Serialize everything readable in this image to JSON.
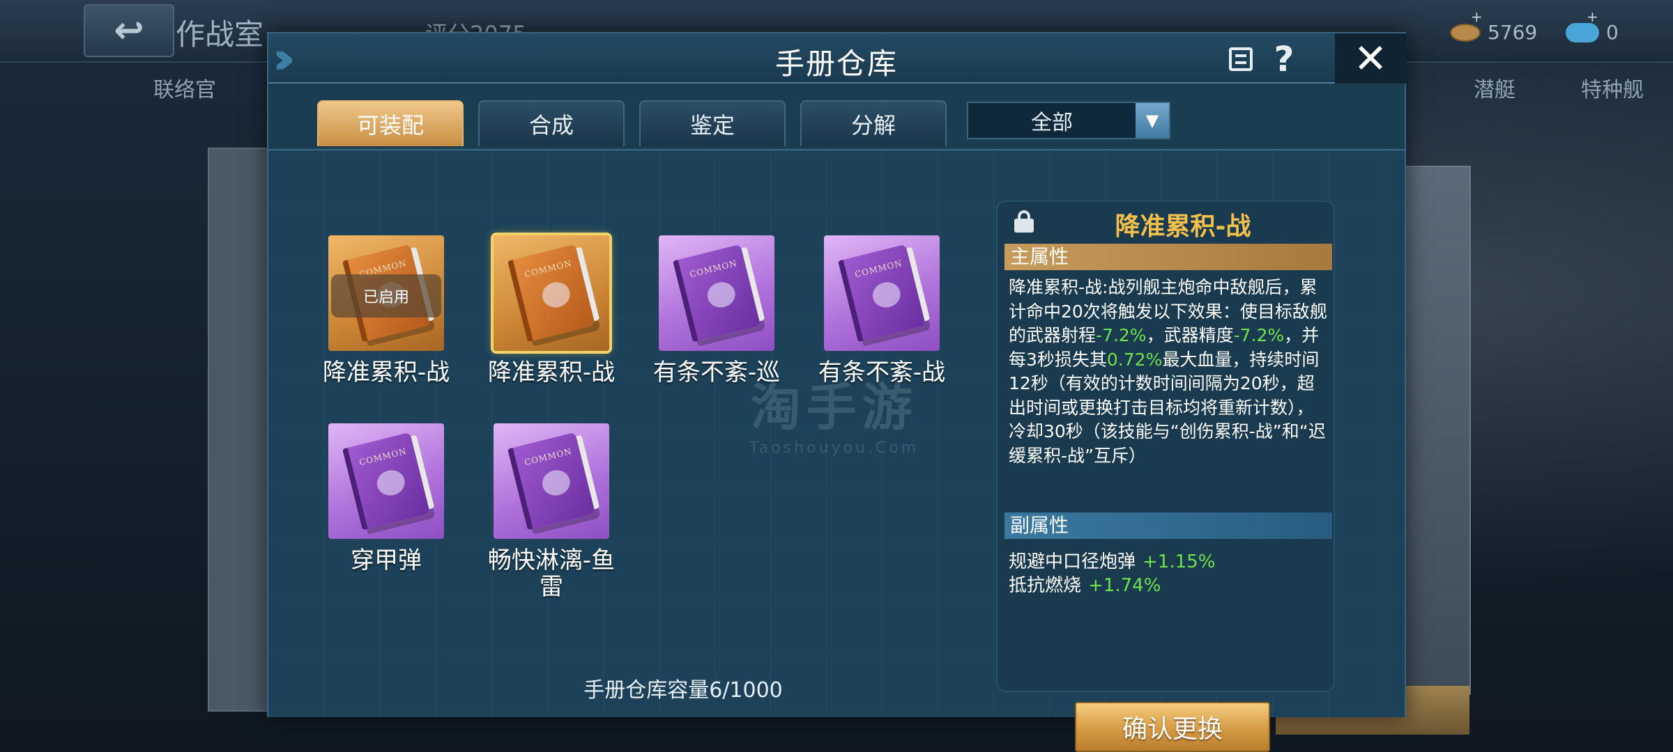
{
  "background": {
    "title": "作战室",
    "score": "评分2075",
    "resources": [
      "5769",
      "0"
    ],
    "tabs": [
      "联络官",
      "潜艇",
      "特种舰"
    ]
  },
  "modal": {
    "title": "手册仓库",
    "tabs": [
      {
        "label": "可装配",
        "active": true
      },
      {
        "label": "合成",
        "active": false
      },
      {
        "label": "鉴定",
        "active": false
      },
      {
        "label": "分解",
        "active": false
      }
    ],
    "filter": {
      "selected": "全部"
    },
    "items": [
      {
        "name": "降准累积-战",
        "color": "orange",
        "cover_text": "COMMON",
        "badge": "已启用",
        "selected": false
      },
      {
        "name": "降准累积-战",
        "color": "orange",
        "cover_text": "COMMON",
        "badge": "",
        "selected": true
      },
      {
        "name": "有条不紊-巡",
        "color": "purple",
        "cover_text": "COMMON",
        "badge": "",
        "selected": false
      },
      {
        "name": "有条不紊-战",
        "color": "purple",
        "cover_text": "COMMON",
        "badge": "",
        "selected": false
      },
      {
        "name": "穿甲弹",
        "color": "purple",
        "cover_text": "COMMON",
        "badge": "",
        "selected": false
      },
      {
        "name": "畅快淋漓-鱼雷",
        "color": "purple",
        "cover_text": "COMMON",
        "badge": "",
        "selected": false
      }
    ],
    "watermark": {
      "main": "淘手游",
      "sub": "Taoshouyou.Com"
    },
    "capacity": "手册仓库容量6/1000",
    "detail": {
      "title": "降准累积-战",
      "main_attr_label": "主属性",
      "desc_parts": [
        {
          "t": "降准累积-战:战列舰主炮命中敌舰后，累计命中20次将触发以下效果：使目标敌舰的武器射程",
          "g": false
        },
        {
          "t": "-7.2%",
          "g": true
        },
        {
          "t": "，武器精度",
          "g": false
        },
        {
          "t": "-7.2%",
          "g": true
        },
        {
          "t": "，并每3秒损失其",
          "g": false
        },
        {
          "t": "0.72%",
          "g": true
        },
        {
          "t": "最大血量，持续时间12秒（有效的计数时间间隔为20秒，超出时间或更换打击目标均将重新计数），冷却30秒（该技能与“创伤累积-战”和“迟缓累积-战”互斥）",
          "g": false
        }
      ],
      "sub_attr_label": "副属性",
      "sub_attrs": [
        {
          "name": "规避中口径炮弹",
          "value": "+1.15%"
        },
        {
          "name": "抵抗燃烧",
          "value": "+1.74%"
        }
      ],
      "confirm_label": "确认更换"
    }
  },
  "colors": {
    "accent_gold": "#f3c04c",
    "positive_green": "#6ee34a",
    "tab_active": "#d59a44"
  }
}
